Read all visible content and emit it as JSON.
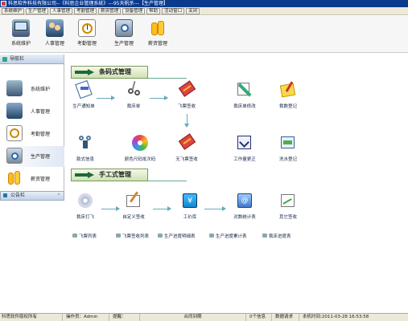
{
  "window": {
    "title": "科思软件科技有限公司--《科思企业管理系统》---95天帆杀---【生产管理】"
  },
  "menu": [
    "系统维护",
    "生产管理",
    "人事管理",
    "考勤管理",
    "薪资管理",
    "设备管理",
    "帮助",
    "活动窗口",
    "关闭"
  ],
  "toolbar": [
    {
      "label": "系统维护",
      "icon": "computer-icon"
    },
    {
      "label": "人事管理",
      "icon": "people-icon"
    },
    {
      "label": "考勤管理",
      "icon": "clock-icon"
    },
    {
      "label": "生产管理",
      "icon": "factory-icon"
    },
    {
      "label": "薪资管理",
      "icon": "coins-icon"
    }
  ],
  "sidebar": {
    "title": "导航栏",
    "items": [
      {
        "label": "系统维护",
        "icon": "computer-icon"
      },
      {
        "label": "人事管理",
        "icon": "people-icon"
      },
      {
        "label": "考勤管理",
        "icon": "clock-icon"
      },
      {
        "label": "生产管理",
        "icon": "factory-icon",
        "active": true
      },
      {
        "label": "薪资管理",
        "icon": "coins-icon"
      }
    ],
    "notice": "公告栏"
  },
  "barcode_section": {
    "title": "条码式管理",
    "row1": [
      {
        "label": "生产通知单",
        "icon": "notice-icon"
      },
      {
        "label": "裁床单",
        "icon": "scissors-icon"
      },
      {
        "label": "飞票签收",
        "icon": "ticket-icon"
      },
      {
        "label": "裁床单修改",
        "icon": "edit-tools-icon"
      },
      {
        "label": "裁数登记",
        "icon": "register-icon"
      }
    ],
    "row2": [
      {
        "label": "款式信息",
        "icon": "style-info-icon"
      },
      {
        "label": "颜色尺码批次码",
        "icon": "color-disc-icon"
      },
      {
        "label": "无飞票签收",
        "icon": "ticket-icon"
      },
      {
        "label": "工作量更正",
        "icon": "correction-icon"
      },
      {
        "label": "洗水登记",
        "icon": "wash-icon"
      }
    ]
  },
  "manual_section": {
    "title": "手工式管理",
    "row": [
      {
        "label": "裁床打飞",
        "icon": "disc-icon"
      },
      {
        "label": "自定义签收",
        "icon": "custom-sign-icon"
      },
      {
        "label": "工价库",
        "icon": "price-icon"
      },
      {
        "label": "对数统计表",
        "icon": "stats-icon"
      },
      {
        "label": "其它签收",
        "icon": "other-sign-icon"
      }
    ]
  },
  "reports": [
    "飞票列表",
    "飞票签收列表",
    "生产进度明细表",
    "生产进度累计表",
    "裁床进度表"
  ],
  "status": {
    "company": "科思软件版权所有",
    "operator": "操作员：Admin",
    "reminder": "提醒：",
    "contract_due": "合同到期",
    "messages": "0个信息",
    "data_request": "数据请求",
    "local_time": "本机时间:2011-03-28 16:53:58"
  },
  "colors": {
    "titlebar": "#0a3a8c",
    "section_head": "#cfe2b4",
    "flow_arrow": "#66aabb"
  }
}
